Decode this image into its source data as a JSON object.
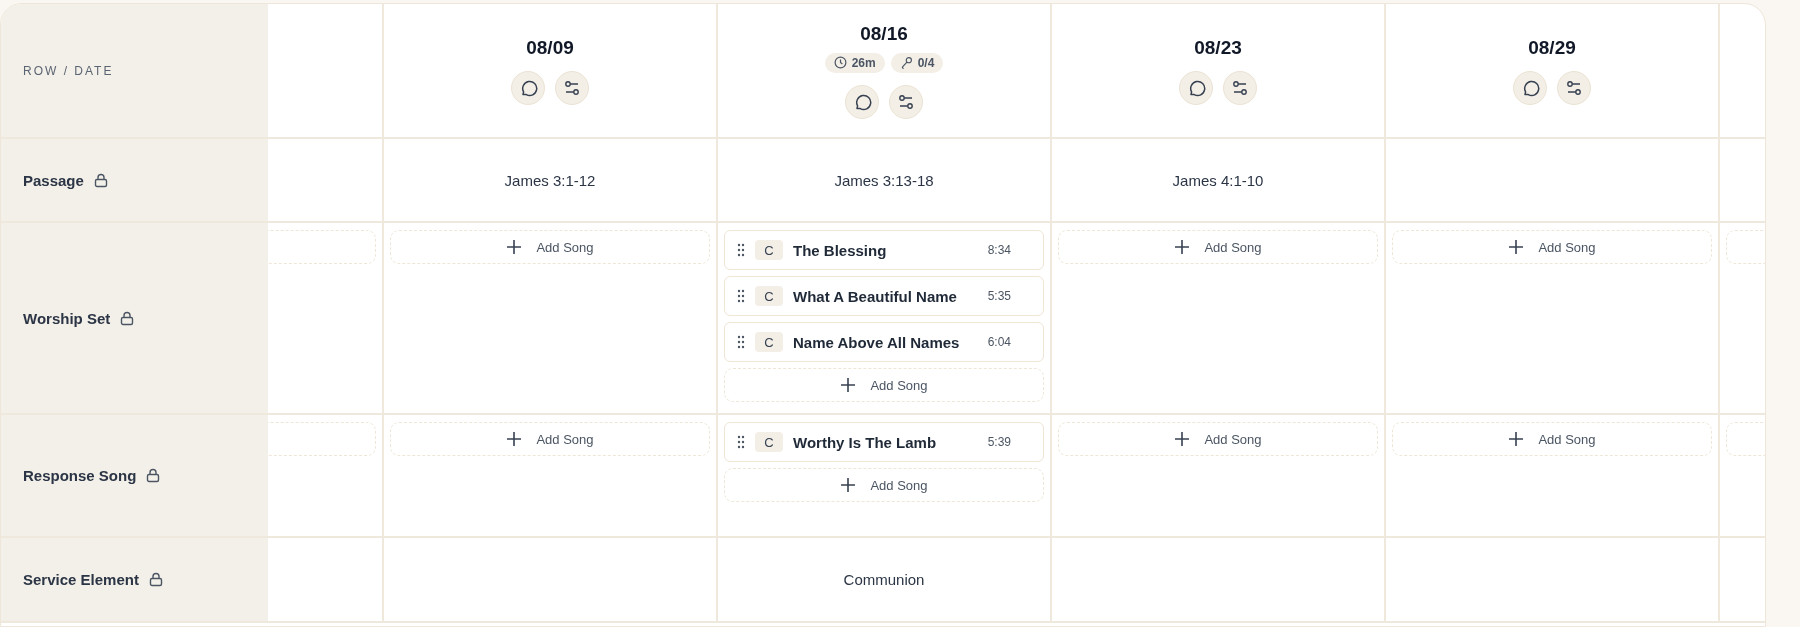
{
  "header_label": "ROW / DATE",
  "rows": [
    {
      "label": "Passage",
      "locked": true
    },
    {
      "label": "Worship Set",
      "locked": true
    },
    {
      "label": "Response Song",
      "locked": true
    },
    {
      "label": "Service Element",
      "locked": true
    }
  ],
  "columns": [
    {
      "kind": "clipped",
      "cells": [
        {
          "kind": "empty"
        },
        {
          "kind": "slot"
        },
        {
          "kind": "slot"
        },
        {
          "kind": "empty"
        }
      ]
    },
    {
      "kind": "date",
      "date": "08/09",
      "cells": [
        {
          "kind": "text",
          "text": "James 3:1-12"
        },
        {
          "kind": "songs",
          "add_label": "Add Song"
        },
        {
          "kind": "songs",
          "add_label": "Add Song"
        },
        {
          "kind": "empty"
        }
      ]
    },
    {
      "kind": "date",
      "date": "08/16",
      "stats": [
        {
          "kind": "time",
          "text": "26m"
        },
        {
          "kind": "singers",
          "text": "0/4"
        }
      ],
      "cells": [
        {
          "kind": "text",
          "text": "James 3:13-18"
        },
        {
          "kind": "songs",
          "add_label": "Add Song",
          "songs": [
            {
              "key": "C",
              "title": "The Blessing",
              "duration": "8:34"
            },
            {
              "key": "C",
              "title": "What A Beautiful Name",
              "duration": "5:35"
            },
            {
              "key": "C",
              "title": "Name Above All Names",
              "duration": "6:04"
            }
          ]
        },
        {
          "kind": "songs",
          "add_label": "Add Song",
          "songs": [
            {
              "key": "C",
              "title": "Worthy Is The Lamb",
              "duration": "5:39"
            }
          ]
        },
        {
          "kind": "text",
          "text": "Communion"
        }
      ]
    },
    {
      "kind": "date",
      "date": "08/23",
      "cells": [
        {
          "kind": "text",
          "text": "James 4:1-10"
        },
        {
          "kind": "songs",
          "add_label": "Add Song"
        },
        {
          "kind": "songs",
          "add_label": "Add Song"
        },
        {
          "kind": "empty"
        }
      ]
    },
    {
      "kind": "date",
      "date": "08/29",
      "cells": [
        {
          "kind": "empty"
        },
        {
          "kind": "songs",
          "add_label": "Add Song"
        },
        {
          "kind": "songs",
          "add_label": "Add Song"
        },
        {
          "kind": "empty"
        }
      ]
    },
    {
      "kind": "clipped",
      "cells": [
        {
          "kind": "empty"
        },
        {
          "kind": "slot"
        },
        {
          "kind": "slot"
        },
        {
          "kind": "empty"
        }
      ]
    }
  ]
}
